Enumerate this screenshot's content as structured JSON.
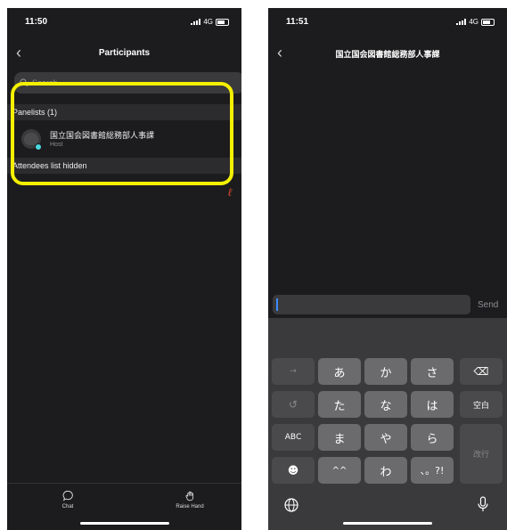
{
  "left": {
    "status": {
      "time": "11:50",
      "network": "4G"
    },
    "title": "Participants",
    "search": {
      "placeholder": "Search"
    },
    "panelists_header": "Panelists (1)",
    "panelist": {
      "name": "国立国会図書館総務部人事課",
      "role": "Host"
    },
    "attendees_header": "Attendees list hidden",
    "tabs": [
      {
        "label": "Chat",
        "icon": "chat-bubble-icon"
      },
      {
        "label": "Raise Hand",
        "icon": "raise-hand-icon"
      }
    ],
    "highlight_color": "#f4f000"
  },
  "right": {
    "status": {
      "time": "11:51",
      "network": "4G"
    },
    "title": "国立国会図書館総務部人事課",
    "message": {
      "value": "",
      "send_label": "Send"
    },
    "keyboard": {
      "row1": [
        "→",
        "あ",
        "か",
        "さ",
        "⌫"
      ],
      "row2": [
        "↺",
        "た",
        "な",
        "は",
        "空白"
      ],
      "row3": [
        "ABC",
        "ま",
        "や",
        "ら"
      ],
      "enter": "改行",
      "row4": [
        "☻",
        "^^",
        "わ",
        "、。?!"
      ],
      "bottom": [
        "globe-icon",
        "microphone-icon"
      ]
    }
  }
}
